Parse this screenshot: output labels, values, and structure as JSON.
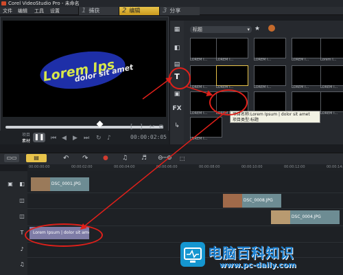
{
  "window": {
    "title": "Corel VideoStudio Pro - 未命名"
  },
  "menu": [
    "文件",
    "编辑",
    "工具",
    "设置"
  ],
  "steps": [
    {
      "num": "1",
      "label": "捕获"
    },
    {
      "num": "2",
      "label": "编辑",
      "active": true
    },
    {
      "num": "3",
      "label": "分享"
    }
  ],
  "preview": {
    "title_main": "Lorem Ips",
    "title_sub": "dolor sit amet",
    "project_label": "项目",
    "clip_label": "素材",
    "timecode": "00:00:02:05"
  },
  "library": {
    "category": "标题",
    "thumb_label": "LOREM I...",
    "thumb_label_last": "Lorem I..."
  },
  "tooltip": {
    "line1": "项目名称:Lorem Ipsum | dolor sit amet",
    "line2": "项目类型:标题"
  },
  "side_icons": [
    "media-icon",
    "transition-icon",
    "title-icon",
    "graphic-icon",
    "fx-icon",
    "path-icon"
  ],
  "side_fx_label": "FX",
  "ruler": [
    "00:00:00:00",
    "00:00:02:00",
    "00:00:04:00",
    "00:00:06:00",
    "00:00:08:00",
    "00:00:10:00",
    "00:00:12:00",
    "00:00:14:00"
  ],
  "clips": {
    "c1": "DSC_0001.JPG",
    "c2": "DSC_0008.JPG",
    "c3": "DSC_0004.JPG",
    "title_clip": "Lorem Ipsum | dolor sit amet"
  },
  "watermark": {
    "brand": "电脑百科知识",
    "url": "www.pc-daily.com"
  },
  "colors": {
    "accent": "#e8c34a",
    "annotation": "#e0201a",
    "title_yellow": "#d8e84a",
    "ellipse": "#1e2fa8",
    "clip": "#6d8c93",
    "title_clip": "#7e7ca6"
  }
}
